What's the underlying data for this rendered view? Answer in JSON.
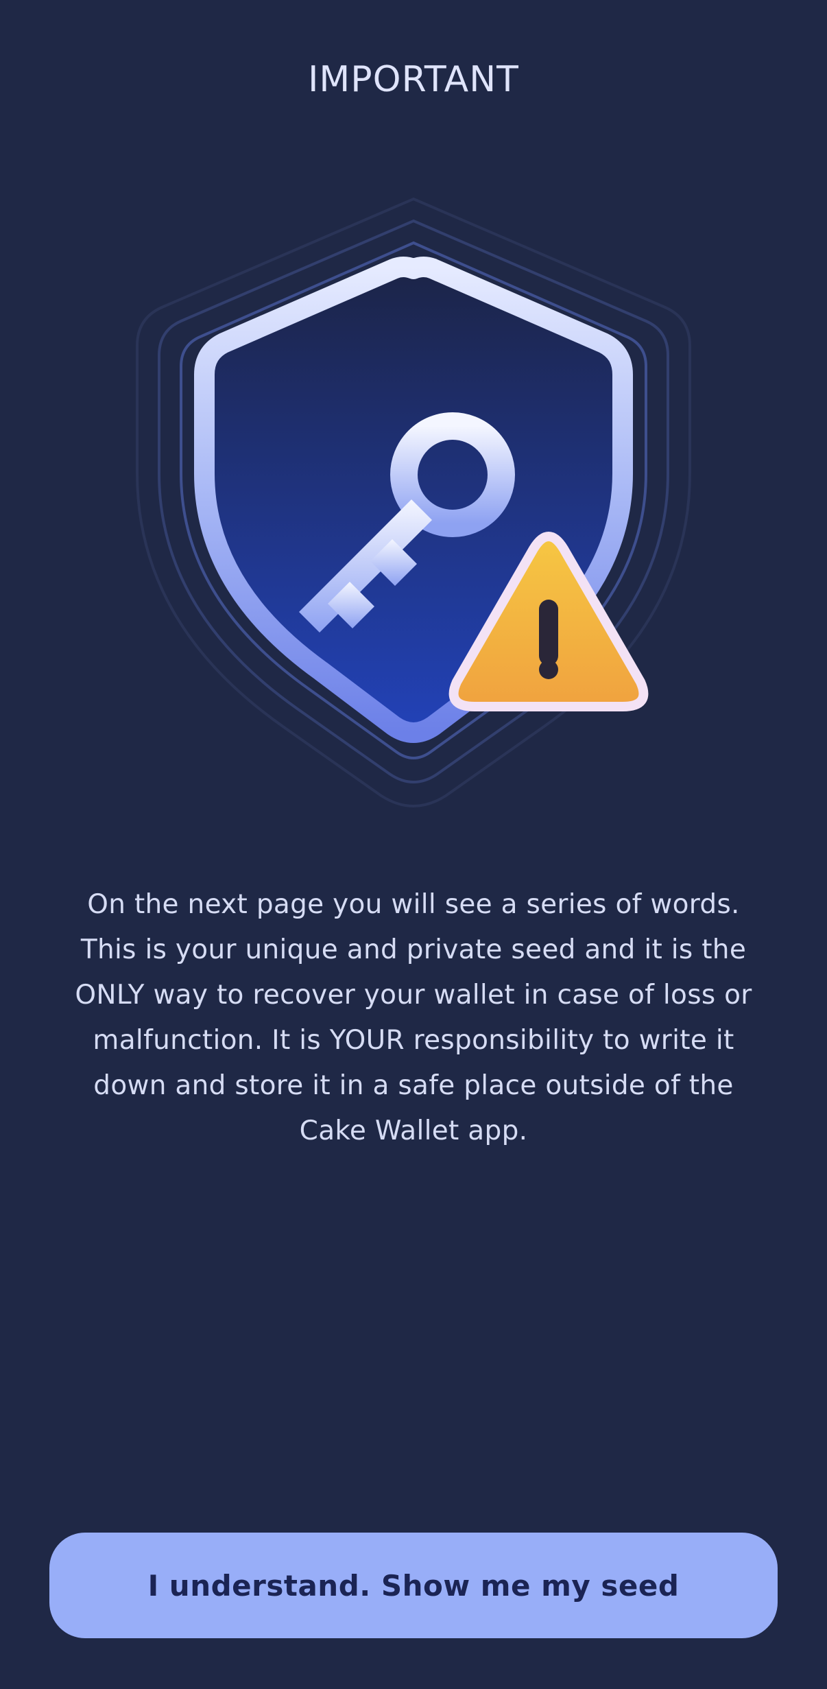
{
  "header": {
    "title": "IMPORTANT"
  },
  "illustration": {
    "shield_icon": "shield-icon",
    "key_icon": "key-icon",
    "warning_icon": "warning-triangle-icon"
  },
  "body": {
    "message": "On the next page you will see a series of words. This is your unique and private seed and it is the ONLY way to recover your wallet in case of loss or malfunction. It is YOUR responsibility to write it down and store it in a safe place outside of the Cake Wallet app."
  },
  "footer": {
    "confirm_label": "I understand. Show me my seed"
  },
  "colors": {
    "background": "#1f2846",
    "button": "#98aef8",
    "button_text": "#1b2454",
    "warning": "#f2b443"
  }
}
